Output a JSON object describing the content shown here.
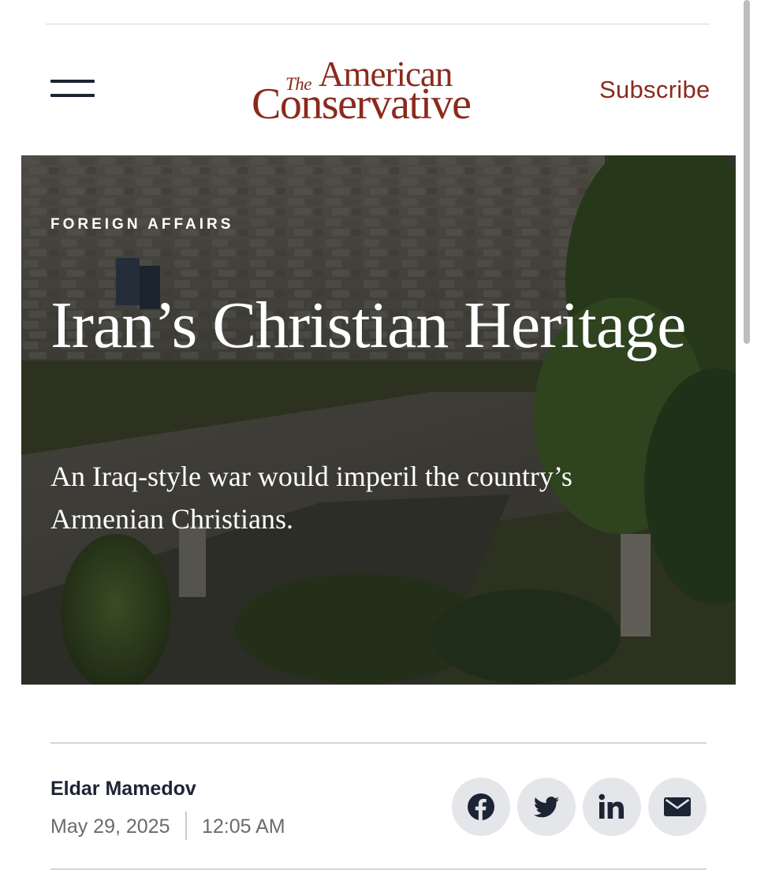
{
  "header": {
    "menu_icon": "hamburger-menu-icon",
    "logo": {
      "the": "The",
      "american": "American",
      "conservative": "Conservative"
    },
    "subscribe_label": "Subscribe"
  },
  "article": {
    "kicker": "FOREIGN AFFAIRS",
    "headline": "Iran’s Christian Heritage",
    "dek": "An Iraq-style war would imperil the country’s Armenian Christians.",
    "author": "Eldar Mamedov",
    "date": "May 29, 2025",
    "time": "12:05 AM"
  },
  "share": {
    "icons": [
      "facebook-icon",
      "twitter-icon",
      "linkedin-icon",
      "email-icon"
    ]
  },
  "colors": {
    "brand": "#8b2a1d",
    "ink": "#1d2433",
    "muted": "#6b6b6b",
    "share_bg": "#e4e6ea"
  }
}
